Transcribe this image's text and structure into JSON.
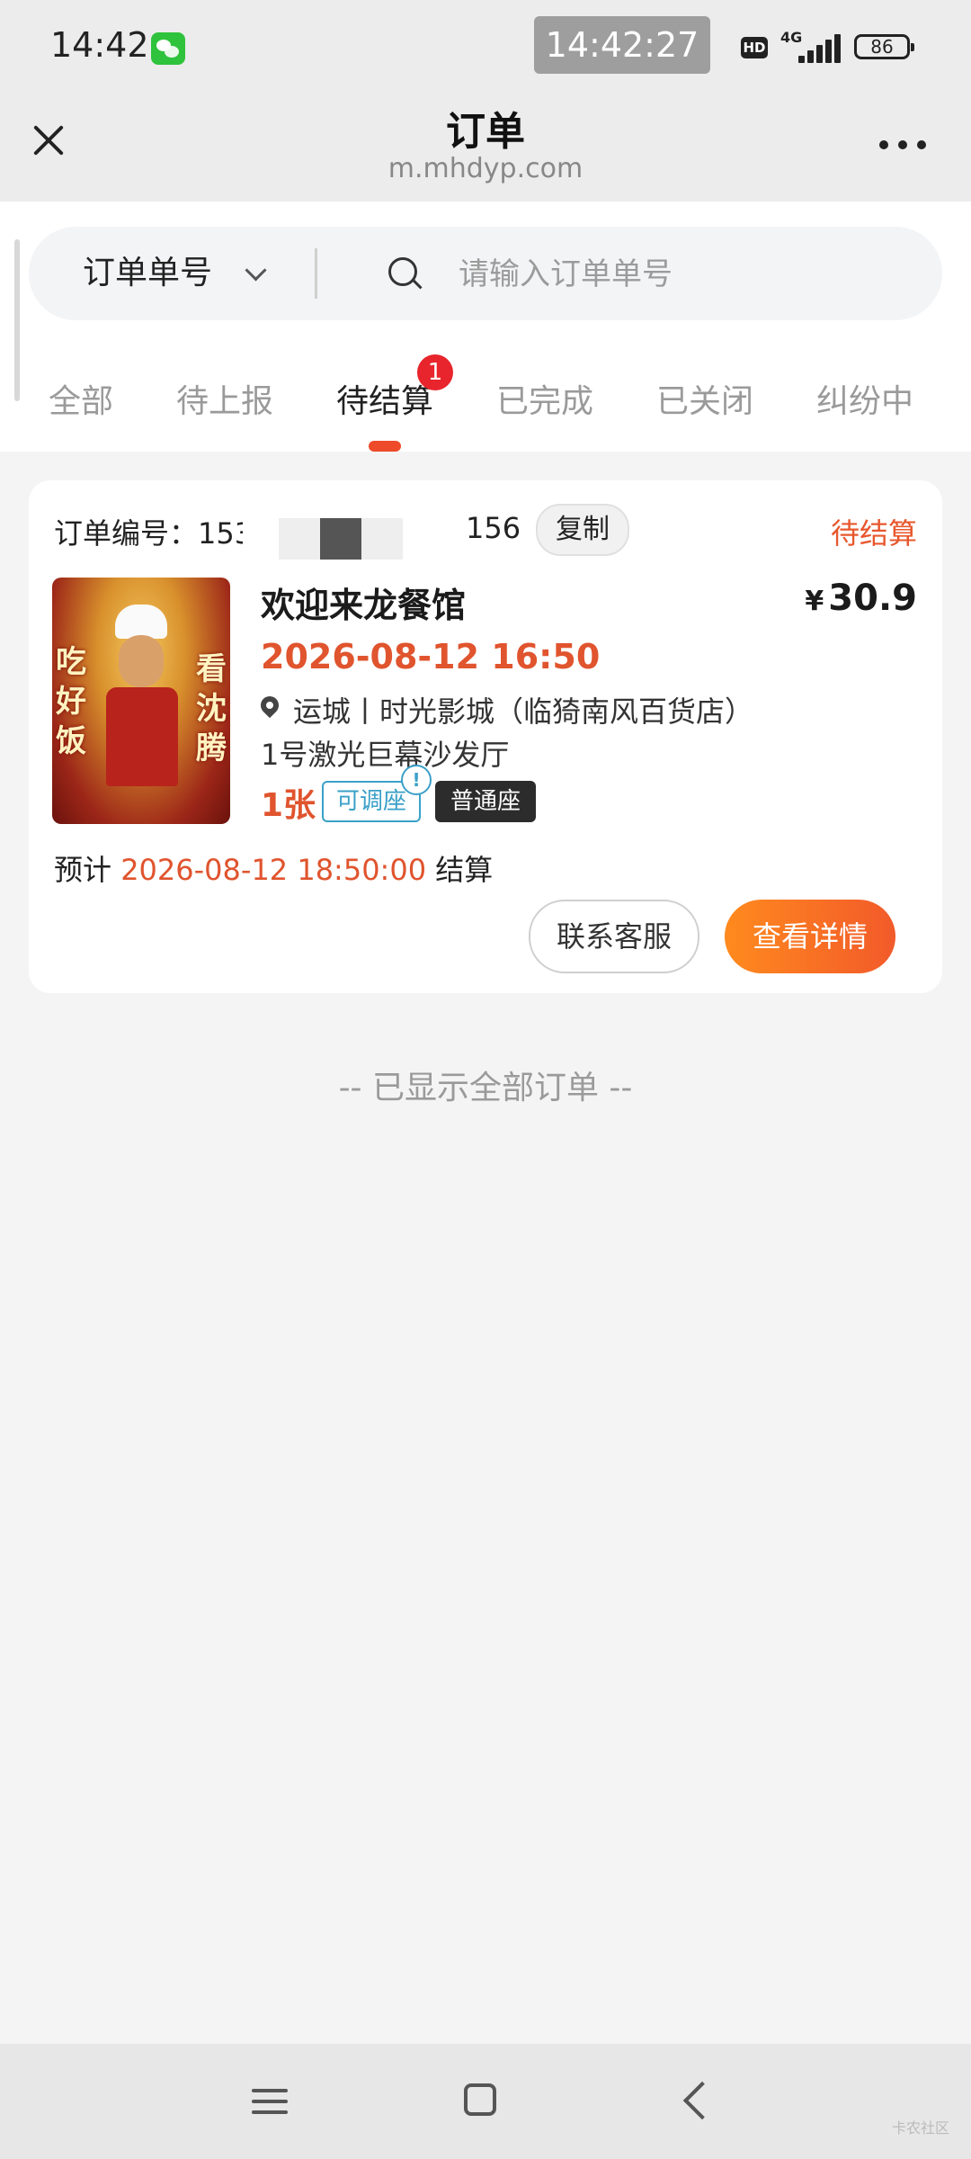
{
  "status_bar": {
    "time": "14:42",
    "clock_overlay": "14:42:27",
    "hd_label": "HD",
    "network": "4G",
    "battery": "86"
  },
  "header": {
    "title": "订单",
    "url": "m.mhdyp.com"
  },
  "search": {
    "type_label": "订单单号",
    "placeholder": "请输入订单单号"
  },
  "tabs": {
    "items": [
      {
        "label": "全部"
      },
      {
        "label": "待上报"
      },
      {
        "label": "待结算"
      },
      {
        "label": "已完成"
      },
      {
        "label": "已关闭"
      },
      {
        "label": "纠纷中"
      }
    ],
    "active_index": 2,
    "badge_count": "1"
  },
  "order": {
    "number_label": "订单编号：153",
    "number_tail": "156",
    "copy_label": "复制",
    "status": "待结算",
    "poster_text_left": "吃好饭",
    "poster_text_right": "看沈腾",
    "movie_title": "欢迎来龙餐馆",
    "price_currency": "¥",
    "price": "30.9",
    "show_time": "2026-08-12 16:50",
    "location": "运城丨时光影城（临猗南风百货店）",
    "hall": "1号激光巨幕沙发厅",
    "ticket_count": "1张",
    "tag_adjustable": "可调座",
    "info_mark": "!",
    "seat_type": "普通座",
    "settle_prefix": "预计",
    "settle_time": "2026-08-12 18:50:00",
    "settle_suffix": "结算",
    "contact_label": "联系客服",
    "detail_label": "查看详情"
  },
  "end_text": "-- 已显示全部订单 --",
  "watermark": "卡农社区",
  "colors": {
    "accent": "#e8572d",
    "badge": "#e8242c",
    "button_gradient_start": "#ff8a1e",
    "button_gradient_end": "#f25a2a",
    "tag_blue": "#3aa0c8"
  }
}
